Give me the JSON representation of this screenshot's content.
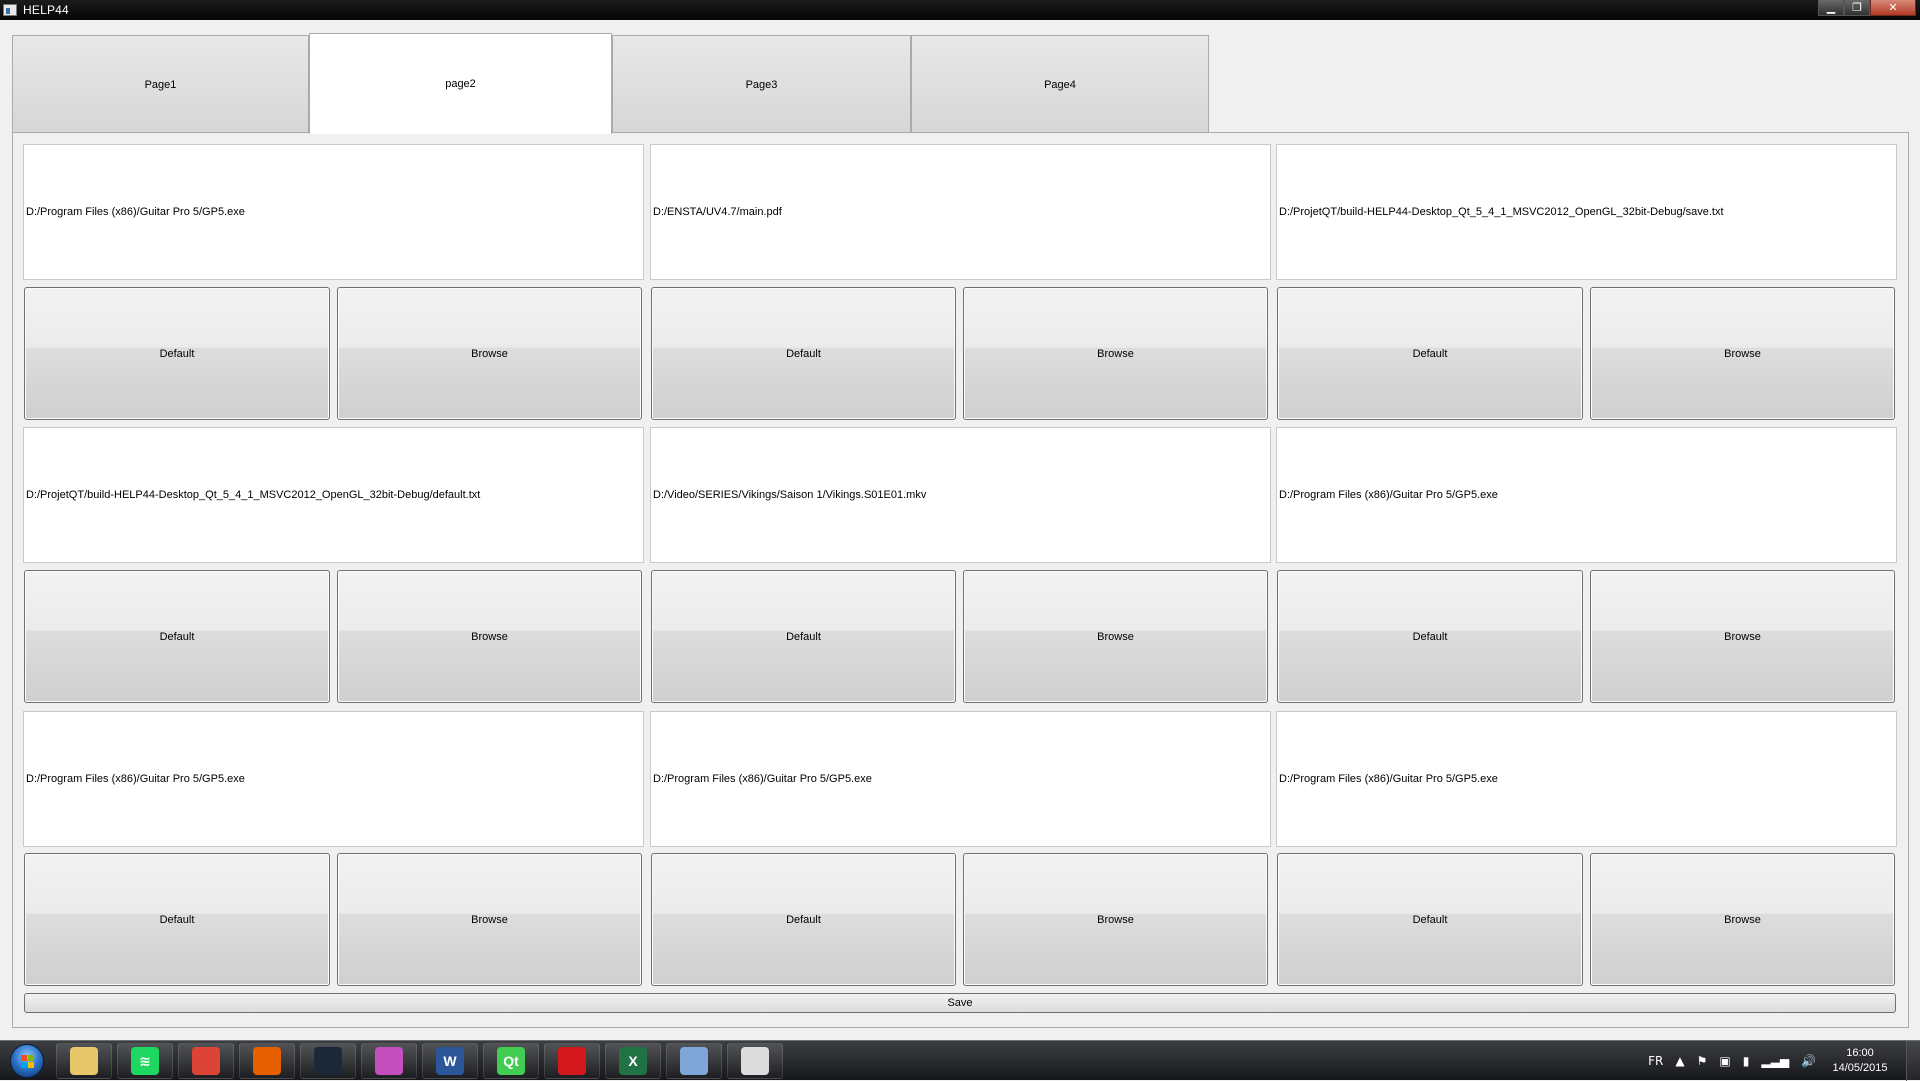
{
  "window": {
    "title": "HELP44",
    "controls": {
      "minimize": "▁",
      "maximize": "❐",
      "close": "✕"
    }
  },
  "tabs": [
    {
      "label": "Page1"
    },
    {
      "label": "page2"
    },
    {
      "label": "Page3"
    },
    {
      "label": "Page4"
    }
  ],
  "active_tab_index": 1,
  "grid": {
    "rows": [
      {
        "cells": [
          {
            "path": "D:/Program Files (x86)/Guitar Pro 5/GP5.exe",
            "default_label": "Default",
            "browse_label": "Browse"
          },
          {
            "path": "D:/ENSTA/UV4.7/main.pdf",
            "default_label": "Default",
            "browse_label": "Browse"
          },
          {
            "path": "D:/ProjetQT/build-HELP44-Desktop_Qt_5_4_1_MSVC2012_OpenGL_32bit-Debug/save.txt",
            "default_label": "Default",
            "browse_label": "Browse"
          }
        ]
      },
      {
        "cells": [
          {
            "path": "D:/ProjetQT/build-HELP44-Desktop_Qt_5_4_1_MSVC2012_OpenGL_32bit-Debug/default.txt",
            "default_label": "Default",
            "browse_label": "Browse"
          },
          {
            "path": "D:/Video/SERIES/Vikings/Saison 1/Vikings.S01E01.mkv",
            "default_label": "Default",
            "browse_label": "Browse"
          },
          {
            "path": "D:/Program Files (x86)/Guitar Pro 5/GP5.exe",
            "default_label": "Default",
            "browse_label": "Browse"
          }
        ]
      },
      {
        "cells": [
          {
            "path": "D:/Program Files (x86)/Guitar Pro 5/GP5.exe",
            "default_label": "Default",
            "browse_label": "Browse"
          },
          {
            "path": "D:/Program Files (x86)/Guitar Pro 5/GP5.exe",
            "default_label": "Default",
            "browse_label": "Browse"
          },
          {
            "path": "D:/Program Files (x86)/Guitar Pro 5/GP5.exe",
            "default_label": "Default",
            "browse_label": "Browse"
          }
        ]
      }
    ]
  },
  "save_label": "Save",
  "taskbar": {
    "apps": [
      {
        "name": "file-explorer-icon",
        "glyph": "",
        "color": "#e8c66a"
      },
      {
        "name": "spotify-icon",
        "glyph": "≋",
        "color": "#1ed760"
      },
      {
        "name": "chrome-icon",
        "glyph": "",
        "color": "#db4437"
      },
      {
        "name": "firefox-icon",
        "glyph": "",
        "color": "#e66000"
      },
      {
        "name": "steam-icon",
        "glyph": "",
        "color": "#1b2838"
      },
      {
        "name": "media-player-icon",
        "glyph": "",
        "color": "#c64fc0"
      },
      {
        "name": "word-icon",
        "glyph": "W",
        "color": "#2b579a"
      },
      {
        "name": "qt-creator-icon",
        "glyph": "Qt",
        "color": "#41cd52"
      },
      {
        "name": "acrobat-icon",
        "glyph": "",
        "color": "#d3191e"
      },
      {
        "name": "excel-icon",
        "glyph": "X",
        "color": "#217346"
      },
      {
        "name": "paint-icon",
        "glyph": "",
        "color": "#7ea6d8"
      },
      {
        "name": "help44-app-icon",
        "glyph": "",
        "color": "#dcdcdc"
      }
    ],
    "language": "FR",
    "time": "16:00",
    "date": "14/05/2015"
  }
}
